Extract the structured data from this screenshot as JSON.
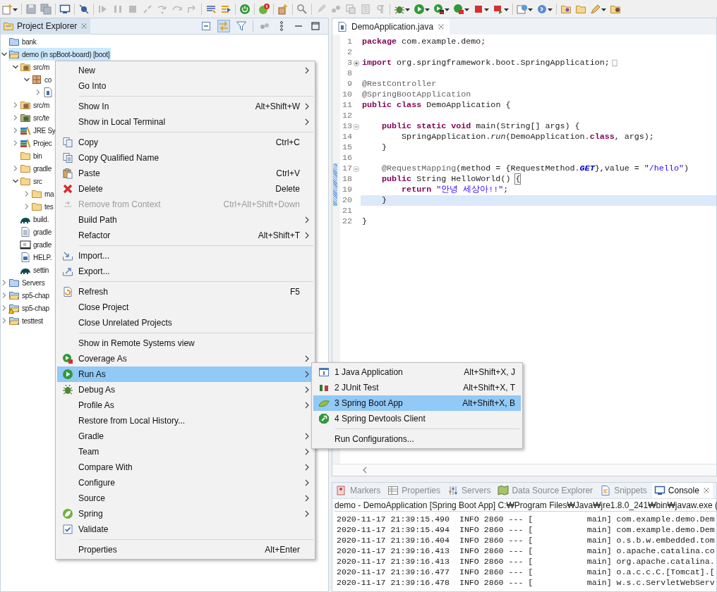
{
  "project_explorer": {
    "tab": {
      "label": "Project Explorer",
      "selected": true
    },
    "tree": [
      {
        "label": "bank",
        "kind": "closed-project",
        "selected": false
      },
      {
        "label": "demo (in spBoot-board) [boot]",
        "kind": "project",
        "selected": true,
        "expanded": true,
        "children": [
          {
            "label": "src/m",
            "kind": "source-folder",
            "selected": false,
            "expanded": true,
            "children": [
              {
                "label": "co",
                "kind": "package",
                "selected": false,
                "expanded": true,
                "children": [
                  {
                    "kind": "java-file",
                    "selected": false,
                    "expanded": false
                  }
                ]
              }
            ]
          },
          {
            "label": "src/m",
            "kind": "source-folder",
            "selected": false,
            "expanded": false
          },
          {
            "label": "src/te",
            "kind": "test-folder",
            "selected": false,
            "expanded": false
          },
          {
            "label": "JRE Sy",
            "kind": "library",
            "selected": false,
            "expanded": false
          },
          {
            "label": "Projec",
            "kind": "library",
            "selected": false,
            "expanded": false
          },
          {
            "label": "bin",
            "kind": "folder",
            "selected": false
          },
          {
            "label": "gradle",
            "kind": "folder",
            "selected": false,
            "expanded": false
          },
          {
            "label": "src",
            "kind": "folder",
            "selected": false,
            "expanded": true,
            "children": [
              {
                "label": "ma",
                "kind": "folder",
                "selected": false,
                "expanded": false
              },
              {
                "label": "tes",
                "kind": "folder",
                "selected": false,
                "expanded": false
              }
            ]
          },
          {
            "label": "build.",
            "kind": "gradle-file",
            "selected": false
          },
          {
            "label": "gradle",
            "kind": "text-file",
            "selected": false
          },
          {
            "label": "gradle",
            "kind": "settings-file",
            "selected": false
          },
          {
            "label": "HELP.",
            "kind": "word-file",
            "selected": false
          },
          {
            "label": "settin",
            "kind": "gradle-file",
            "selected": false
          }
        ]
      },
      {
        "label": "Servers",
        "kind": "closed-project",
        "selected": false,
        "expanded": false
      },
      {
        "label": "sp5-chap",
        "kind": "project",
        "selected": false,
        "expanded": false
      },
      {
        "label": "sp5-chap",
        "kind": "project-warning",
        "selected": false,
        "expanded": false
      },
      {
        "label": "testtest",
        "kind": "project",
        "selected": false,
        "expanded": false
      }
    ]
  },
  "editor": {
    "tab": {
      "label": "DemoApplication.java",
      "selected": true
    },
    "lines": [
      {
        "number": "1",
        "changed": false,
        "current": false,
        "tokens": [
          {
            "text": "package",
            "kind": "keyword"
          },
          {
            "text": " com.example.demo;",
            "kind": "plain"
          }
        ]
      },
      {
        "number": "2",
        "changed": false,
        "current": false
      },
      {
        "number": "3",
        "changed": false,
        "current": false,
        "folded": true,
        "tokens": [
          {
            "text": "import",
            "kind": "keyword"
          },
          {
            "text": " org.springframework.boot.SpringApplication;",
            "kind": "plain"
          }
        ]
      },
      {
        "number": "8",
        "changed": false,
        "current": false
      },
      {
        "number": "9",
        "changed": false,
        "current": false,
        "tokens": [
          {
            "text": "@RestController",
            "kind": "annotation"
          }
        ]
      },
      {
        "number": "10",
        "changed": false,
        "current": false,
        "tokens": [
          {
            "text": "@SpringBootApplication",
            "kind": "annotation"
          }
        ]
      },
      {
        "number": "11",
        "changed": false,
        "current": false,
        "tokens": [
          {
            "text": "public class",
            "kind": "keyword"
          },
          {
            "text": " DemoApplication {",
            "kind": "plain"
          }
        ]
      },
      {
        "number": "12",
        "changed": false,
        "current": false
      },
      {
        "number": "13",
        "changed": false,
        "current": false,
        "folded": false,
        "tokens": [
          {
            "text": "    public static void",
            "kind": "keyword"
          },
          {
            "text": " main(String[] args) {",
            "kind": "plain"
          }
        ]
      },
      {
        "number": "14",
        "changed": false,
        "current": false,
        "tokens": [
          {
            "text": "        SpringApplication.",
            "kind": "plain"
          },
          {
            "text": "run",
            "kind": "static-method"
          },
          {
            "text": "(DemoApplication.",
            "kind": "plain"
          },
          {
            "text": "class",
            "kind": "keyword"
          },
          {
            "text": ", args);",
            "kind": "plain"
          }
        ]
      },
      {
        "number": "15",
        "changed": false,
        "current": false,
        "tokens": [
          {
            "text": "    }",
            "kind": "plain"
          }
        ]
      },
      {
        "number": "16",
        "changed": false,
        "current": false
      },
      {
        "number": "17",
        "changed": true,
        "current": false,
        "folded": false,
        "tokens": [
          {
            "text": "    @RequestMapping",
            "kind": "annotation"
          },
          {
            "text": "(method = {RequestMethod.",
            "kind": "plain"
          },
          {
            "text": "GET",
            "kind": "constant"
          },
          {
            "text": "},value = ",
            "kind": "plain"
          },
          {
            "text": "\"/hello\"",
            "kind": "string"
          },
          {
            "text": ")",
            "kind": "plain"
          }
        ]
      },
      {
        "number": "18",
        "changed": true,
        "current": false,
        "tokens": [
          {
            "text": "    public",
            "kind": "keyword"
          },
          {
            "text": " String HelloWorld() ",
            "kind": "plain"
          },
          {
            "text": "{",
            "kind": "bracket-match"
          }
        ]
      },
      {
        "number": "19",
        "changed": true,
        "current": false,
        "tokens": [
          {
            "text": "        return",
            "kind": "keyword"
          },
          {
            "text": " \"안녕 세상아!!\"",
            "kind": "string"
          },
          {
            "text": ";",
            "kind": "plain"
          }
        ]
      },
      {
        "number": "20",
        "changed": true,
        "current": true,
        "tokens": [
          {
            "text": "    }",
            "kind": "plain"
          }
        ]
      },
      {
        "number": "21",
        "changed": false,
        "current": false
      },
      {
        "number": "22",
        "changed": false,
        "current": false,
        "tokens": [
          {
            "text": "}",
            "kind": "plain"
          }
        ]
      }
    ]
  },
  "bottom_panel": {
    "tabs": [
      {
        "label": "Markers",
        "selected": false
      },
      {
        "label": "Properties",
        "selected": false
      },
      {
        "label": "Servers",
        "selected": false
      },
      {
        "label": "Data Source Explorer",
        "selected": false
      },
      {
        "label": "Snippets",
        "selected": false
      },
      {
        "label": "Console",
        "selected": true
      }
    ],
    "console": {
      "header": "demo - DemoApplication [Spring Boot App] C:₩Program Files₩Java₩jre1.8.0_241₩bin₩javaw.exe  (",
      "lines": [
        "2020-11-17 21:39:15.490  INFO 2860 --- [           main] com.example.demo.Dem",
        "2020-11-17 21:39:15.494  INFO 2860 --- [           main] com.example.demo.Dem",
        "2020-11-17 21:39:16.404  INFO 2860 --- [           main] o.s.b.w.embedded.tom",
        "2020-11-17 21:39:16.413  INFO 2860 --- [           main] o.apache.catalina.co",
        "2020-11-17 21:39:16.413  INFO 2860 --- [           main] org.apache.catalina.",
        "2020-11-17 21:39:16.477  INFO 2860 --- [           main] o.a.c.c.C.[Tomcat].[",
        "2020-11-17 21:39:16.478  INFO 2860 --- [           main] w.s.c.ServletWebServ"
      ]
    }
  },
  "context_menu": {
    "items": [
      {
        "kind": "item",
        "label": "New",
        "submenu": true,
        "disabled": false,
        "selected": false
      },
      {
        "kind": "item",
        "label": "Go Into",
        "submenu": false,
        "disabled": false,
        "selected": false
      },
      {
        "kind": "separator"
      },
      {
        "kind": "item",
        "label": "Show In",
        "shortcut": "Alt+Shift+W",
        "submenu": true,
        "disabled": false,
        "selected": false
      },
      {
        "kind": "item",
        "label": "Show in Local Terminal",
        "submenu": true,
        "disabled": false,
        "selected": false
      },
      {
        "kind": "separator"
      },
      {
        "kind": "item",
        "label": "Copy",
        "shortcut": "Ctrl+C",
        "submenu": false,
        "disabled": false,
        "selected": false
      },
      {
        "kind": "item",
        "label": "Copy Qualified Name",
        "submenu": false,
        "disabled": false,
        "selected": false
      },
      {
        "kind": "item",
        "label": "Paste",
        "shortcut": "Ctrl+V",
        "submenu": false,
        "disabled": false,
        "selected": false
      },
      {
        "kind": "item",
        "label": "Delete",
        "shortcut": "Delete",
        "submenu": false,
        "disabled": false,
        "selected": false
      },
      {
        "kind": "item",
        "label": "Remove from Context",
        "shortcut": "Ctrl+Alt+Shift+Down",
        "submenu": false,
        "disabled": true,
        "selected": false
      },
      {
        "kind": "item",
        "label": "Build Path",
        "submenu": true,
        "disabled": false,
        "selected": false
      },
      {
        "kind": "item",
        "label": "Refactor",
        "shortcut": "Alt+Shift+T",
        "submenu": true,
        "disabled": false,
        "selected": false
      },
      {
        "kind": "separator"
      },
      {
        "kind": "item",
        "label": "Import...",
        "submenu": false,
        "disabled": false,
        "selected": false
      },
      {
        "kind": "item",
        "label": "Export...",
        "submenu": false,
        "disabled": false,
        "selected": false
      },
      {
        "kind": "separator"
      },
      {
        "kind": "item",
        "label": "Refresh",
        "shortcut": "F5",
        "submenu": false,
        "disabled": false,
        "selected": false
      },
      {
        "kind": "item",
        "label": "Close Project",
        "submenu": false,
        "disabled": false,
        "selected": false
      },
      {
        "kind": "item",
        "label": "Close Unrelated Projects",
        "submenu": false,
        "disabled": false,
        "selected": false
      },
      {
        "kind": "separator"
      },
      {
        "kind": "item",
        "label": "Show in Remote Systems view",
        "submenu": false,
        "disabled": false,
        "selected": false
      },
      {
        "kind": "item",
        "label": "Coverage As",
        "submenu": true,
        "disabled": false,
        "selected": false
      },
      {
        "kind": "item",
        "label": "Run As",
        "submenu": true,
        "disabled": false,
        "selected": true
      },
      {
        "kind": "item",
        "label": "Debug As",
        "submenu": true,
        "disabled": false,
        "selected": false
      },
      {
        "kind": "item",
        "label": "Profile As",
        "submenu": true,
        "disabled": false,
        "selected": false
      },
      {
        "kind": "item",
        "label": "Restore from Local History...",
        "submenu": false,
        "disabled": false,
        "selected": false
      },
      {
        "kind": "item",
        "label": "Gradle",
        "submenu": true,
        "disabled": false,
        "selected": false
      },
      {
        "kind": "item",
        "label": "Team",
        "submenu": true,
        "disabled": false,
        "selected": false
      },
      {
        "kind": "item",
        "label": "Compare With",
        "submenu": true,
        "disabled": false,
        "selected": false
      },
      {
        "kind": "item",
        "label": "Configure",
        "submenu": true,
        "disabled": false,
        "selected": false
      },
      {
        "kind": "item",
        "label": "Source",
        "submenu": true,
        "disabled": false,
        "selected": false
      },
      {
        "kind": "item",
        "label": "Spring",
        "submenu": true,
        "disabled": false,
        "selected": false
      },
      {
        "kind": "item",
        "label": "Validate",
        "submenu": false,
        "disabled": false,
        "selected": false
      },
      {
        "kind": "separator"
      },
      {
        "kind": "item",
        "label": "Properties",
        "shortcut": "Alt+Enter",
        "submenu": false,
        "disabled": false,
        "selected": false
      }
    ]
  },
  "run_as_submenu": {
    "items": [
      {
        "kind": "item",
        "label": "1 Java Application",
        "shortcut": "Alt+Shift+X, J",
        "selected": false
      },
      {
        "kind": "item",
        "label": "2 JUnit Test",
        "shortcut": "Alt+Shift+X, T",
        "selected": false
      },
      {
        "kind": "item",
        "label": "3 Spring Boot App",
        "shortcut": "Alt+Shift+X, B",
        "selected": true
      },
      {
        "kind": "item",
        "label": "4 Spring Devtools Client",
        "selected": false
      },
      {
        "kind": "separator"
      },
      {
        "kind": "item",
        "label": "Run Configurations...",
        "selected": false
      }
    ]
  }
}
